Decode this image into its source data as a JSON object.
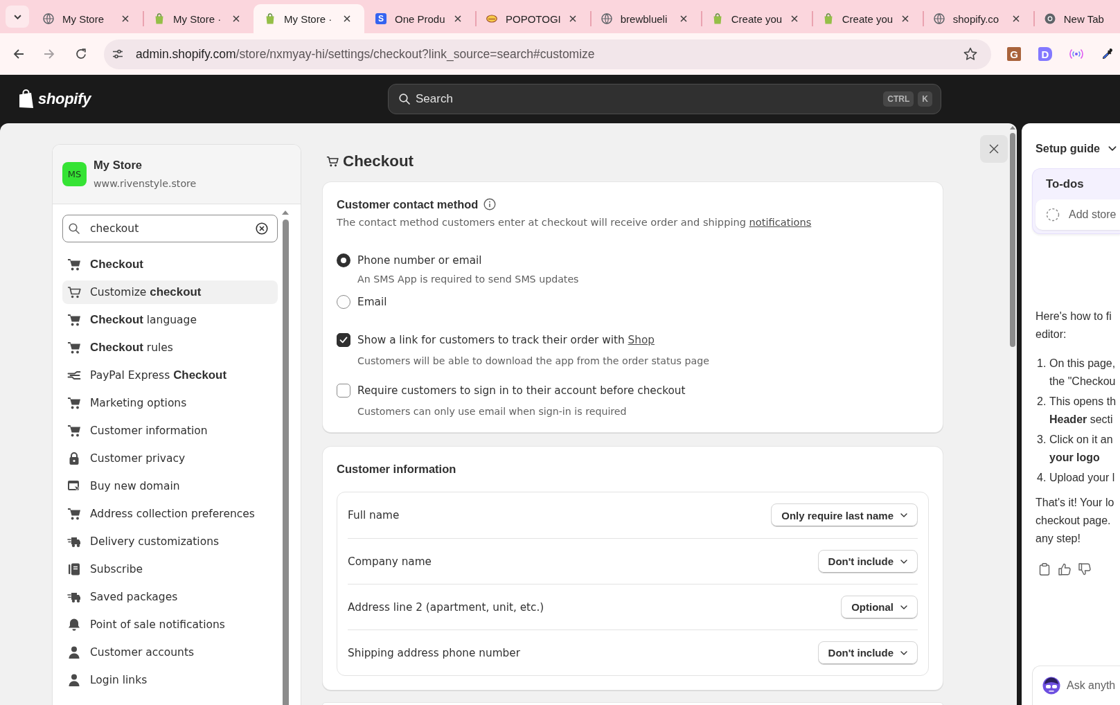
{
  "browser": {
    "tabs": [
      {
        "title": "My Store",
        "selected": false
      },
      {
        "title": "My Store ·",
        "selected": false
      },
      {
        "title": "My Store ·",
        "selected": true
      },
      {
        "title": "One Produ",
        "icon_letter": "S",
        "selected": false
      },
      {
        "title": "POPOTOGI",
        "selected": false
      },
      {
        "title": "brewblueli",
        "selected": false
      },
      {
        "title": "Create you",
        "selected": false
      },
      {
        "title": "Create you",
        "selected": false
      },
      {
        "title": "shopify.co",
        "selected": false
      },
      {
        "title": "New Tab",
        "selected": false
      }
    ],
    "address_bar": {
      "host": "admin.shopify.com",
      "path": "/store/nxmyay-hi/settings/checkout?link_source=search#customize"
    },
    "extensions": [
      "G",
      "D"
    ]
  },
  "topbar": {
    "logo_text": "shopify",
    "search": {
      "placeholder": "Search",
      "shortcut": [
        "CTRL",
        "K"
      ]
    }
  },
  "sidebar": {
    "store": {
      "initials": "MS",
      "name": "My Store",
      "domain": "www.rivenstyle.store"
    },
    "search": {
      "value": "checkout"
    },
    "items": [
      {
        "label": "Checkout",
        "bold": true,
        "selected": false
      },
      {
        "label": "Customize **checkout**",
        "bold": false,
        "selected": true
      },
      {
        "label": "**Checkout** language",
        "bold": false,
        "selected": false
      },
      {
        "label": "**Checkout** rules",
        "bold": false,
        "selected": false
      },
      {
        "label": "PayPal Express **Checkout**",
        "bold": false,
        "selected": false
      },
      {
        "label": "Marketing options",
        "bold": false,
        "selected": false
      },
      {
        "label": "Customer information",
        "bold": false,
        "selected": false
      },
      {
        "label": "Customer privacy",
        "bold": false,
        "selected": false
      },
      {
        "label": "Buy new domain",
        "bold": false,
        "selected": false
      },
      {
        "label": "Address collection preferences",
        "bold": false,
        "selected": false
      },
      {
        "label": "Delivery customizations",
        "bold": false,
        "selected": false
      },
      {
        "label": "Subscribe",
        "bold": false,
        "selected": false
      },
      {
        "label": "Saved packages",
        "bold": false,
        "selected": false
      },
      {
        "label": "Point of sale notifications",
        "bold": false,
        "selected": false
      },
      {
        "label": "Customer accounts",
        "bold": false,
        "selected": false
      },
      {
        "label": "Login links",
        "bold": false,
        "selected": false
      }
    ]
  },
  "page": {
    "title": "Checkout",
    "contact_method": {
      "heading": "Customer contact method",
      "description": "The contact method customers enter at checkout will receive order and shipping",
      "description_link": "notifications",
      "options": [
        {
          "label": "Phone number or email",
          "helper": "An SMS App is required to send SMS updates",
          "selected": true
        },
        {
          "label": "Email",
          "selected": false
        }
      ],
      "checkboxes": [
        {
          "label": "Show a link for customers to track their order with",
          "link": "Shop",
          "helper": "Customers will be able to download the app from the order status page",
          "checked": true
        },
        {
          "label": "Require customers to sign in to their account before checkout",
          "helper": "Customers can only use email when sign-in is required",
          "checked": false
        }
      ]
    },
    "customer_information": {
      "heading": "Customer information",
      "fields": [
        {
          "label": "Full name",
          "value": "Only require last name"
        },
        {
          "label": "Company name",
          "value": "Don't include"
        },
        {
          "label": "Address line 2 (apartment, unit, etc.)",
          "value": "Optional"
        },
        {
          "label": "Shipping address phone number",
          "value": "Don't include"
        }
      ]
    }
  },
  "assistant": {
    "title": "Setup guide",
    "todos": {
      "heading": "To-dos",
      "item": "Add store"
    },
    "intro_lines": [
      "Here's how to fi",
      "editor:"
    ],
    "steps": [
      {
        "number": "1.",
        "lines": [
          "On this page,",
          "the \"Checkou"
        ]
      },
      {
        "number": "2.",
        "lines": [
          "This opens th",
          "**Header** secti"
        ]
      },
      {
        "number": "3.",
        "lines": [
          "Click on it an",
          "**your logo**"
        ]
      },
      {
        "number": "4.",
        "lines": [
          "Upload your l"
        ]
      }
    ],
    "outro_lines": [
      "That's it! Your lo",
      "checkout page.",
      "any step!"
    ],
    "input": {
      "placeholder": "Ask anyth"
    }
  }
}
